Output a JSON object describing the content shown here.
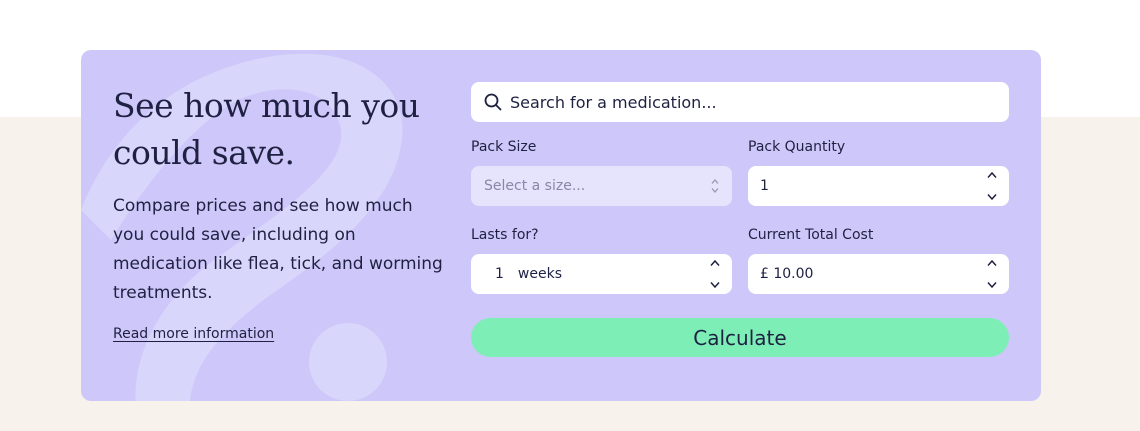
{
  "heading": "See how much you could save.",
  "description": "Compare prices and see how much you could save, including on medication like flea, tick, and worming treatments.",
  "read_more": "Read more information",
  "search": {
    "placeholder": "Search for a medication..."
  },
  "pack_size": {
    "label": "Pack Size",
    "placeholder": "Select a size..."
  },
  "pack_quantity": {
    "label": "Pack Quantity",
    "value": "1"
  },
  "lasts_for": {
    "label": "Lasts for?",
    "value": "1",
    "unit": "weeks"
  },
  "current_total_cost": {
    "label": "Current Total Cost",
    "value": "£ 10.00"
  },
  "calculate_label": "Calculate",
  "colors": {
    "page_bottom": "#f8f2ec",
    "card": "#cdc8f9",
    "deco": "#d9d6fc",
    "select_bg": "#e6e3fc",
    "calculate_button": "#7deeb6",
    "text": "#1f2142"
  },
  "icons": [
    "search-icon",
    "select-chevrons-icon",
    "stepper-up-icon",
    "stepper-down-icon"
  ]
}
